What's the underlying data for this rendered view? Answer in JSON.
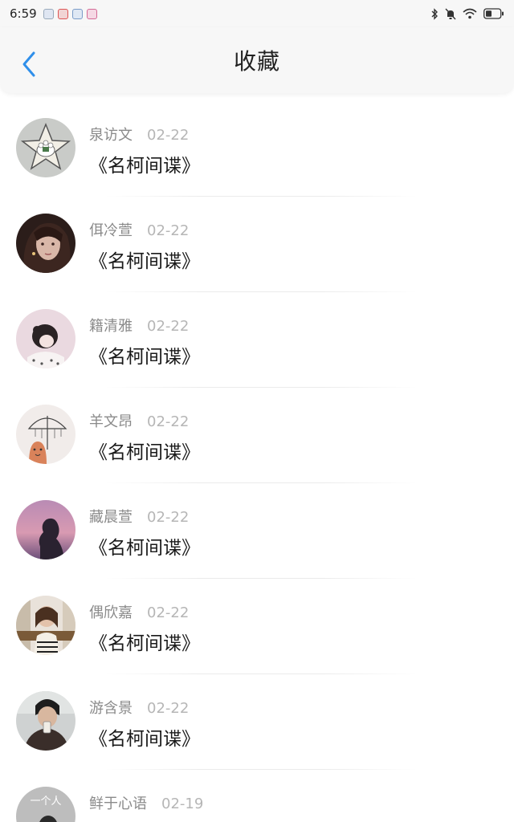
{
  "status_bar": {
    "time": "6:59",
    "notification_icons": [
      "app-icon-blue",
      "app-icon-red",
      "app-icon-shield",
      "app-icon-pink"
    ],
    "indicators": [
      "bluetooth-icon",
      "mute-icon",
      "wifi-icon",
      "battery-icon"
    ]
  },
  "header": {
    "title": "收藏",
    "back_icon": "chevron-left-icon",
    "accent": "#2f8fea"
  },
  "items": [
    {
      "author": "泉访文",
      "date": "02-22",
      "title": "《名柯间谍》",
      "avatar": "avatar-star-sheep"
    },
    {
      "author": "佴冷萱",
      "date": "02-22",
      "title": "《名柯间谍》",
      "avatar": "avatar-girl-portrait"
    },
    {
      "author": "籍清雅",
      "date": "02-22",
      "title": "《名柯间谍》",
      "avatar": "avatar-cartoon-girl"
    },
    {
      "author": "羊文昂",
      "date": "02-22",
      "title": "《名柯间谍》",
      "avatar": "avatar-umbrella-drawing"
    },
    {
      "author": "藏晨萱",
      "date": "02-22",
      "title": "《名柯间谍》",
      "avatar": "avatar-sunset-silhouette"
    },
    {
      "author": "偶欣嘉",
      "date": "02-22",
      "title": "《名柯间谍》",
      "avatar": "avatar-girl-street"
    },
    {
      "author": "游含景",
      "date": "02-22",
      "title": "《名柯间谍》",
      "avatar": "avatar-boy-cup"
    },
    {
      "author": "鲜于心语",
      "date": "02-19",
      "title": "",
      "avatar": "avatar-text-portrait"
    }
  ],
  "avatar_texts": {
    "item7": "一个人"
  }
}
